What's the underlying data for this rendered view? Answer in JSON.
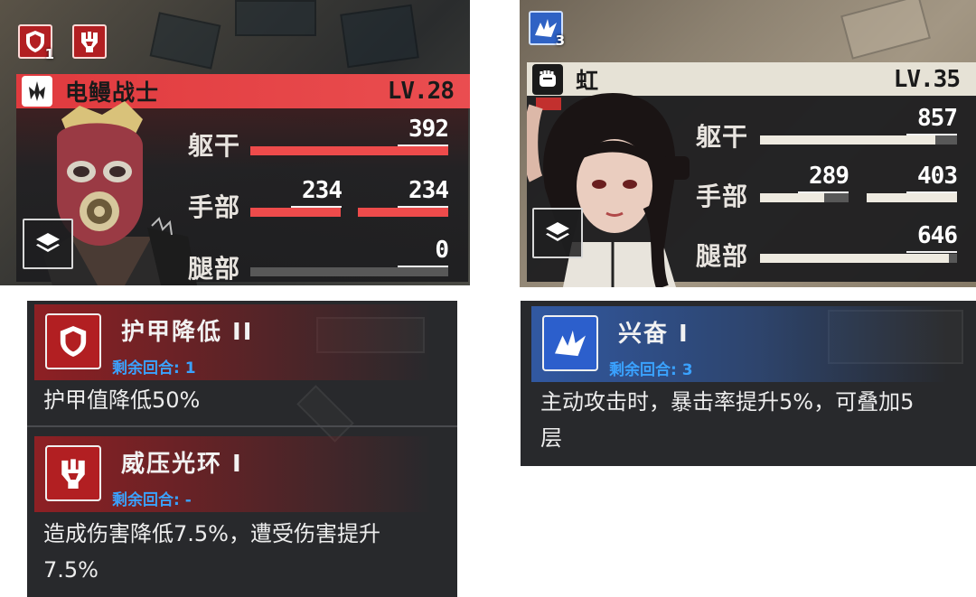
{
  "left_unit": {
    "name": "电鳗战士",
    "level": "LV.28",
    "buff_stack": "1",
    "parts": {
      "body": {
        "label": "躯干",
        "value": "392",
        "fill": 1.0
      },
      "arm": {
        "label": "手部",
        "left_value": "234",
        "right_value": "234",
        "left_fill": 1.0,
        "right_fill": 1.0
      },
      "leg": {
        "label": "腿部",
        "value": "0",
        "fill": 0.0
      }
    },
    "icons": [
      "armor-down-icon",
      "intimidate-aura-icon",
      "class-blade-icon",
      "layers-icon"
    ],
    "accent": "#e84a4c"
  },
  "right_unit": {
    "name": "虹",
    "level": "LV.35",
    "buff_stack": "3",
    "parts": {
      "body": {
        "label": "躯干",
        "value": "857",
        "fill": 0.89
      },
      "arm": {
        "label": "手部",
        "left_value": "289",
        "right_value": "403",
        "left_fill": 0.72,
        "right_fill": 1.0
      },
      "leg": {
        "label": "腿部",
        "value": "646",
        "fill": 0.96
      }
    },
    "icons": [
      "excite-icon",
      "class-fist-icon",
      "layers-icon"
    ],
    "accent": "#eeeae0"
  },
  "detail_left": {
    "buffs": [
      {
        "name": "护甲降低 II",
        "turns_label": "剩余回合: 1",
        "desc_lines": [
          "护甲值降低50%"
        ],
        "icon": "armor-down-icon"
      },
      {
        "name": "威压光环 I",
        "turns_label": "剩余回合: -",
        "desc_lines": [
          "造成伤害降低7.5%，遭受伤害提升",
          "7.5%"
        ],
        "icon": "intimidate-aura-icon"
      }
    ]
  },
  "detail_right": {
    "buffs": [
      {
        "name": "兴奋 I",
        "turns_label": "剩余回合: 3",
        "desc_lines": [
          "主动攻击时，暴击率提升5%，可叠加5",
          "层"
        ],
        "icon": "excite-icon"
      }
    ]
  }
}
